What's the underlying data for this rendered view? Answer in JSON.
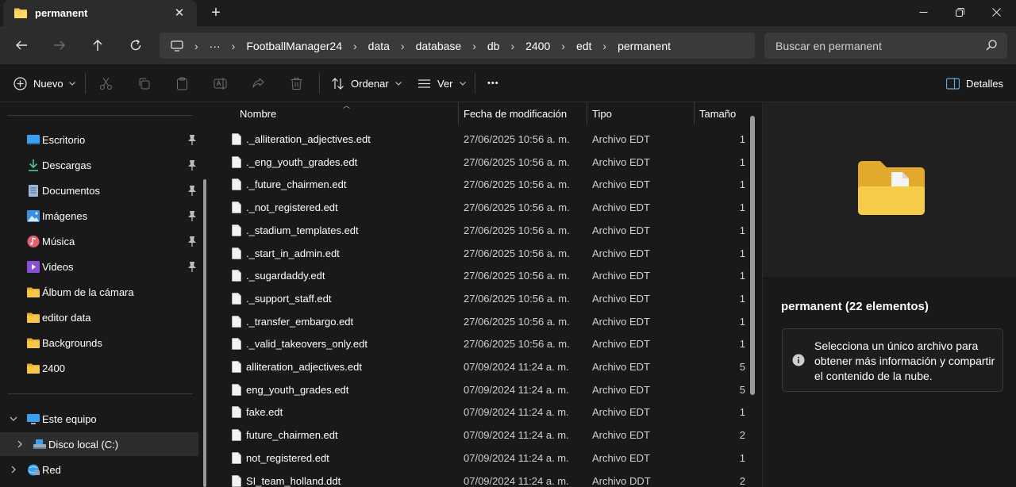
{
  "window": {
    "tab_title": "permanent",
    "tab_close": "✕",
    "new_tab": "+"
  },
  "breadcrumb": {
    "overflow": "···",
    "items": [
      "FootballManager24",
      "data",
      "database",
      "db",
      "2400",
      "edt",
      "permanent"
    ]
  },
  "search": {
    "placeholder": "Buscar en permanent"
  },
  "toolbar": {
    "new_label": "Nuevo",
    "sort_label": "Ordenar",
    "view_label": "Ver",
    "more_label": "•••",
    "details_label": "Detalles"
  },
  "sidebar": {
    "quick_access": [
      {
        "label": "Escritorio",
        "icon": "desktop-icon",
        "pinned": true
      },
      {
        "label": "Descargas",
        "icon": "download-icon",
        "pinned": true
      },
      {
        "label": "Documentos",
        "icon": "documents-icon",
        "pinned": true
      },
      {
        "label": "Imágenes",
        "icon": "images-icon",
        "pinned": true
      },
      {
        "label": "Música",
        "icon": "music-icon",
        "pinned": true
      },
      {
        "label": "Videos",
        "icon": "videos-icon",
        "pinned": true
      },
      {
        "label": "Álbum de la cámara",
        "icon": "folder-icon",
        "pinned": false
      },
      {
        "label": "editor data",
        "icon": "folder-icon",
        "pinned": false
      },
      {
        "label": "Backgrounds",
        "icon": "folder-icon",
        "pinned": false
      },
      {
        "label": "2400",
        "icon": "folder-icon",
        "pinned": false
      }
    ],
    "this_pc": "Este equipo",
    "local_disk": "Disco local (C:)",
    "network": "Red"
  },
  "columns": {
    "name": "Nombre",
    "modified": "Fecha de modificación",
    "type": "Tipo",
    "size": "Tamaño"
  },
  "files": [
    {
      "name": "._alliteration_adjectives.edt",
      "modified": "27/06/2025 10:56 a. m.",
      "type": "Archivo EDT",
      "size": "1"
    },
    {
      "name": "._eng_youth_grades.edt",
      "modified": "27/06/2025 10:56 a. m.",
      "type": "Archivo EDT",
      "size": "1"
    },
    {
      "name": "._future_chairmen.edt",
      "modified": "27/06/2025 10:56 a. m.",
      "type": "Archivo EDT",
      "size": "1"
    },
    {
      "name": "._not_registered.edt",
      "modified": "27/06/2025 10:56 a. m.",
      "type": "Archivo EDT",
      "size": "1"
    },
    {
      "name": "._stadium_templates.edt",
      "modified": "27/06/2025 10:56 a. m.",
      "type": "Archivo EDT",
      "size": "1"
    },
    {
      "name": "._start_in_admin.edt",
      "modified": "27/06/2025 10:56 a. m.",
      "type": "Archivo EDT",
      "size": "1"
    },
    {
      "name": "._sugardaddy.edt",
      "modified": "27/06/2025 10:56 a. m.",
      "type": "Archivo EDT",
      "size": "1"
    },
    {
      "name": "._support_staff.edt",
      "modified": "27/06/2025 10:56 a. m.",
      "type": "Archivo EDT",
      "size": "1"
    },
    {
      "name": "._transfer_embargo.edt",
      "modified": "27/06/2025 10:56 a. m.",
      "type": "Archivo EDT",
      "size": "1"
    },
    {
      "name": "._valid_takeovers_only.edt",
      "modified": "27/06/2025 10:56 a. m.",
      "type": "Archivo EDT",
      "size": "1"
    },
    {
      "name": "alliteration_adjectives.edt",
      "modified": "07/09/2024 11:24 a. m.",
      "type": "Archivo EDT",
      "size": "5"
    },
    {
      "name": "eng_youth_grades.edt",
      "modified": "07/09/2024 11:24 a. m.",
      "type": "Archivo EDT",
      "size": "5"
    },
    {
      "name": "fake.edt",
      "modified": "07/09/2024 11:24 a. m.",
      "type": "Archivo EDT",
      "size": "1"
    },
    {
      "name": "future_chairmen.edt",
      "modified": "07/09/2024 11:24 a. m.",
      "type": "Archivo EDT",
      "size": "2"
    },
    {
      "name": "not_registered.edt",
      "modified": "07/09/2024 11:24 a. m.",
      "type": "Archivo EDT",
      "size": "1"
    },
    {
      "name": "SI_team_holland.ddt",
      "modified": "07/09/2024 11:24 a. m.",
      "type": "Archivo DDT",
      "size": "2"
    }
  ],
  "details": {
    "title": "permanent (22 elementos)",
    "info": "Selecciona un único archivo para obtener más información y compartir el contenido de la nube."
  },
  "colors": {
    "folder_yellow": "#f3c443",
    "background": "#191919",
    "accent_blue": "#3aa0f0"
  }
}
